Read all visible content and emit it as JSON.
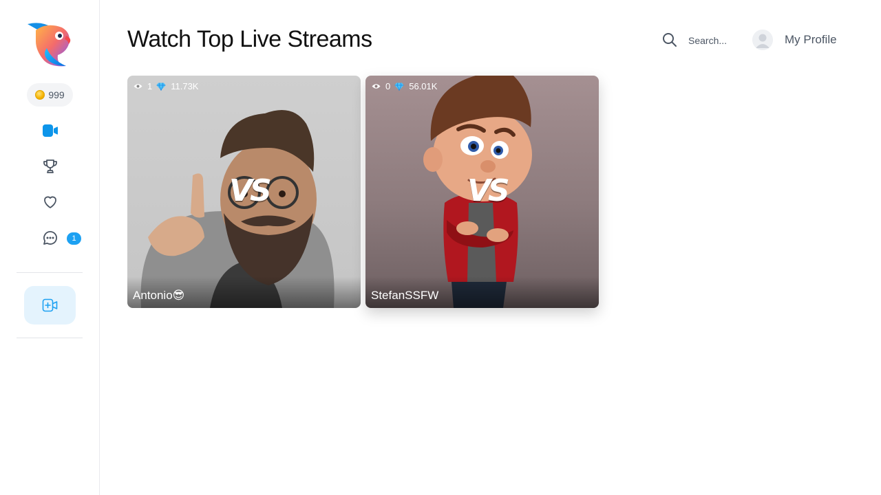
{
  "sidebar": {
    "coins": "999",
    "messages_badge": "1",
    "nav_icons": [
      "video-camera-icon",
      "trophy-icon",
      "heart-icon",
      "chat-bubble-icon"
    ],
    "go_live_icon": "add-video-icon"
  },
  "header": {
    "title": "Watch Top Live Streams",
    "search_placeholder": "Search...",
    "profile_label": "My Profile"
  },
  "streams": [
    {
      "name": "Antonio😎",
      "viewers": "1",
      "diamonds": "11.73K",
      "vs_label": "VS"
    },
    {
      "name": "StefanSSFW",
      "viewers": "0",
      "diamonds": "56.01K",
      "vs_label": "VS"
    }
  ],
  "colors": {
    "accent": "#1da1f2",
    "go_live_bg": "#e4f3fd",
    "coin": "#f5b400"
  }
}
